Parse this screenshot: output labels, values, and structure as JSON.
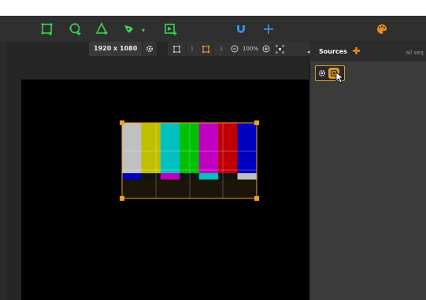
{
  "canvas": {
    "resolution_label": "1920 x 1080"
  },
  "viewport": {
    "counter_a": "1",
    "counter_b": "1",
    "zoom_label": "100%"
  },
  "sources_panel": {
    "title": "Sources",
    "filter_label": "all seq"
  },
  "colors": {
    "tool_green": "#39d353",
    "accent_blue": "#3c8ae8",
    "accent_orange": "#f08a1c",
    "selection": "#f0a020"
  },
  "toolbar": {
    "icons": [
      "rectangle-tool-icon",
      "ellipse-tool-icon",
      "polygon-tool-icon",
      "pen-tool-icon",
      "add-sequence-icon",
      "magnet-icon",
      "add-icon",
      "palette-icon"
    ]
  },
  "test_pattern": {
    "top_bars": [
      "#c0c0c0",
      "#c0c000",
      "#00c0c0",
      "#00c000",
      "#c000c0",
      "#c00000",
      "#0000c0"
    ],
    "mid_bars": [
      "#0000c0",
      "#131313",
      "#c000c0",
      "#131313",
      "#00c0c0",
      "#131313",
      "#c0c0c0"
    ]
  }
}
